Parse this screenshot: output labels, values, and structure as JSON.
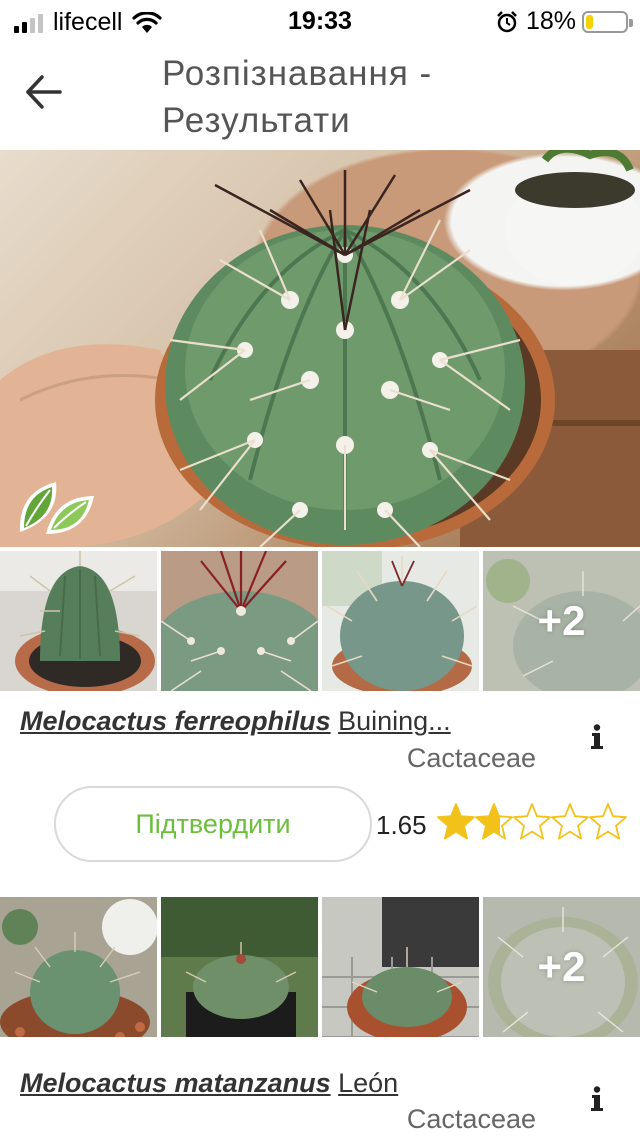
{
  "status_bar": {
    "carrier": "lifecell",
    "time": "19:33",
    "battery": "18%",
    "battery_level": 0.18,
    "signal_bars_active": 2,
    "signal_bars_total": 4
  },
  "header": {
    "title": "Розпізнавання - Результати",
    "back_icon": "arrow-left-icon"
  },
  "colors": {
    "accent_green": "#6cbf3d",
    "star_gold": "#f2c21b"
  },
  "results": [
    {
      "species": "Melocactus ferreophilus",
      "author": "Buining...",
      "family": "Cactaceae",
      "more_images": "+2",
      "confirm_label": "Підтвердити",
      "score": "1.65",
      "rating": 1.65,
      "rating_max": 5
    },
    {
      "species": "Melocactus matanzanus",
      "author": "León",
      "family": "Cactaceae",
      "more_images": "+2"
    }
  ]
}
